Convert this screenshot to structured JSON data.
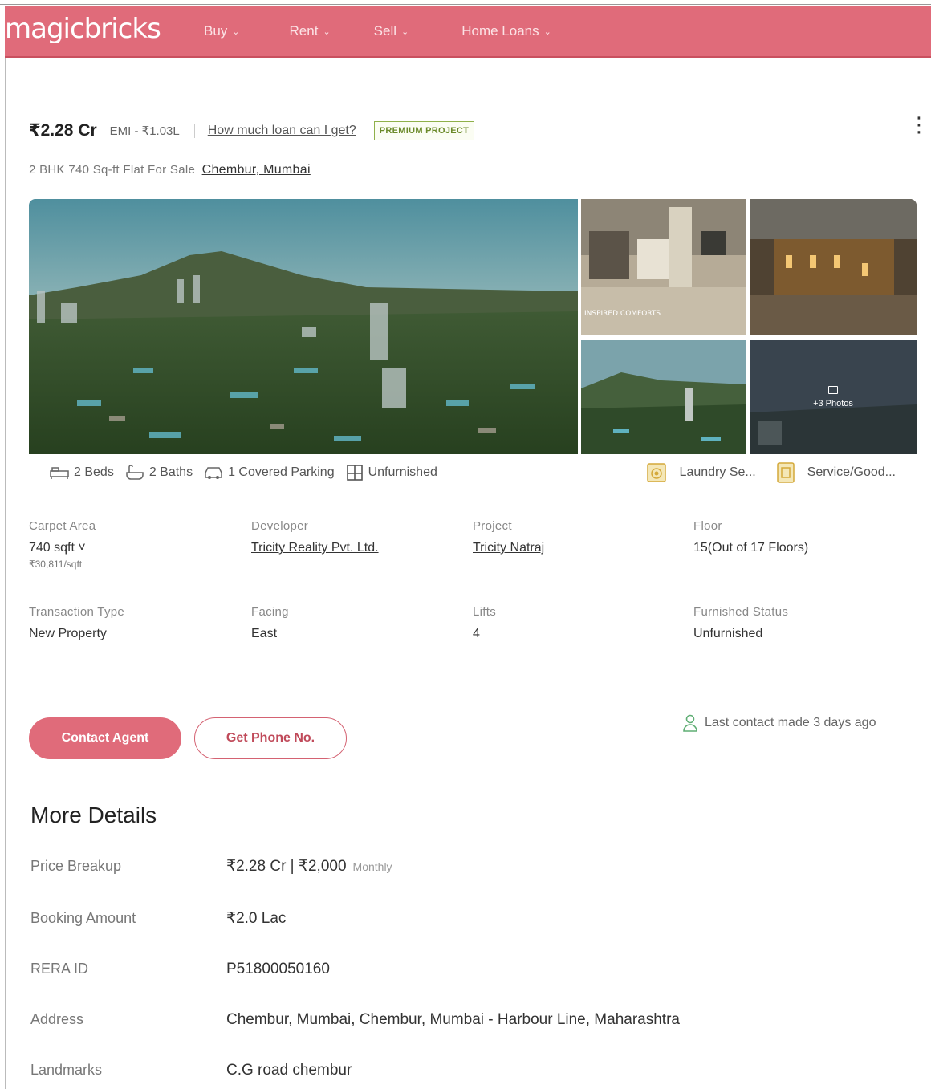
{
  "header": {
    "logo": "magicbricks",
    "nav": [
      {
        "label": "Buy"
      },
      {
        "label": "Rent"
      },
      {
        "label": "Sell"
      },
      {
        "label": "Home Loans"
      }
    ]
  },
  "listing": {
    "price": "₹2.28 Cr",
    "emi": "EMI - ₹1.03L",
    "loan_link": "How much loan can I get?",
    "badge": "PREMIUM PROJECT",
    "subtitle": "2 BHK 740 Sq-ft Flat For Sale",
    "location": "Chembur, Mumbai"
  },
  "gallery": {
    "more_photos": "+3 Photos",
    "thumb1_caption": "INSPIRED COMFORTS"
  },
  "amenities": {
    "beds": "2 Beds",
    "baths": "2 Baths",
    "parking": "1 Covered Parking",
    "furnishing": "Unfurnished",
    "laundry": "Laundry Se...",
    "service": "Service/Good..."
  },
  "specs": {
    "carpet_area": {
      "label": "Carpet Area",
      "value": "740 sqft ˅",
      "sub": "₹30,811/sqft"
    },
    "developer": {
      "label": "Developer",
      "value": "Tricity Reality Pvt. Ltd."
    },
    "project": {
      "label": "Project",
      "value": "Tricity Natraj"
    },
    "floor": {
      "label": "Floor",
      "value": "15(Out of 17 Floors)"
    },
    "transaction": {
      "label": "Transaction Type",
      "value": "New Property"
    },
    "facing": {
      "label": "Facing",
      "value": "East"
    },
    "lifts": {
      "label": "Lifts",
      "value": "4"
    },
    "furnished": {
      "label": "Furnished Status",
      "value": "Unfurnished"
    }
  },
  "actions": {
    "contact": "Contact Agent",
    "phone": "Get Phone No.",
    "last_contact": "Last contact made 3 days ago"
  },
  "more_details": {
    "title": "More Details",
    "price_breakup": {
      "label": "Price Breakup",
      "value": "₹2.28 Cr | ₹2,000",
      "suffix": "Monthly"
    },
    "booking": {
      "label": "Booking Amount",
      "value": "₹2.0 Lac"
    },
    "rera": {
      "label": "RERA ID",
      "value": "P51800050160"
    },
    "address": {
      "label": "Address",
      "value": "Chembur, Mumbai, Chembur, Mumbai - Harbour Line, Maharashtra"
    },
    "landmarks": {
      "label": "Landmarks",
      "value": "C.G road chembur"
    }
  },
  "colors": {
    "brand": "#e06b7a",
    "premium": "#8fb04a"
  }
}
